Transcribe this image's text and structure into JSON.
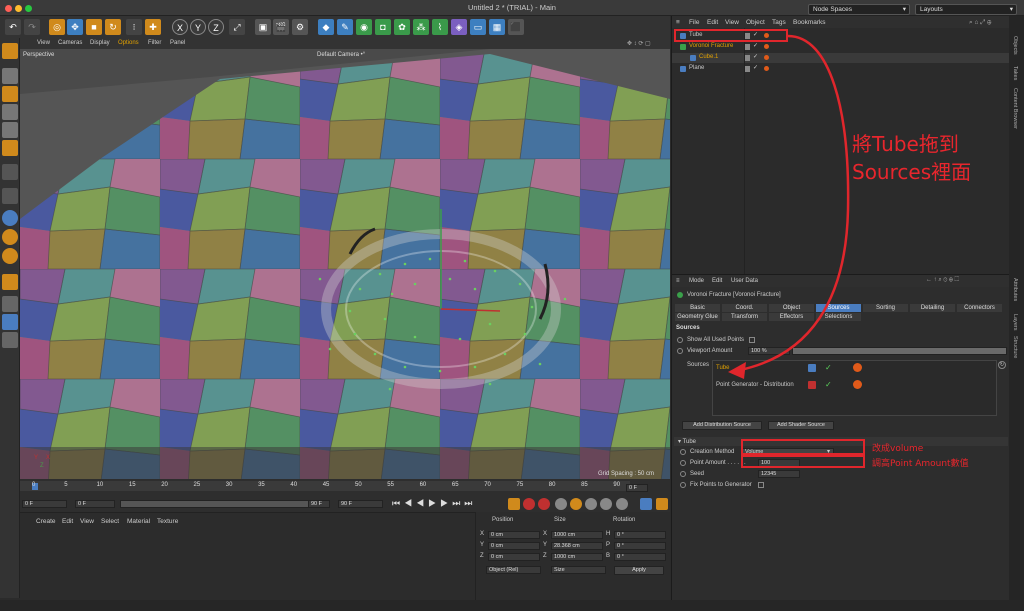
{
  "window": {
    "title": "Untitled 2 * (TRIAL) - Main",
    "node_spaces": "Node Spaces",
    "layouts": "Layouts"
  },
  "toolbar": {
    "x": "X",
    "y": "Y",
    "z": "Z"
  },
  "viewport": {
    "menu": [
      "View",
      "Cameras",
      "Display",
      "Options",
      "Filter",
      "Panel"
    ],
    "label": "Perspective",
    "camera": "Default Camera •°",
    "grid_spacing": "Grid Spacing : 50 cm"
  },
  "timeline": {
    "ticks": [
      "0",
      "5",
      "10",
      "15",
      "20",
      "25",
      "30",
      "35",
      "40",
      "45",
      "50",
      "55",
      "60",
      "65",
      "70",
      "75",
      "80",
      "85",
      "90"
    ],
    "end_frame": "0 F",
    "f1": "0 F",
    "f2": "0 F",
    "f3": "90 F",
    "f4": "90 F"
  },
  "material_manager": {
    "menu": [
      "Create",
      "Edit",
      "View",
      "Select",
      "Material",
      "Texture"
    ]
  },
  "coordinates": {
    "headers": [
      "Position",
      "Size",
      "Rotation"
    ],
    "rows": [
      {
        "axis": "X",
        "pos": "0 cm",
        "saxis": "X",
        "size": "1000 cm",
        "raxis": "H",
        "rot": "0 °"
      },
      {
        "axis": "Y",
        "pos": "0 cm",
        "saxis": "Y",
        "size": "28.368 cm",
        "raxis": "P",
        "rot": "0 °"
      },
      {
        "axis": "Z",
        "pos": "0 cm",
        "saxis": "Z",
        "size": "1000 cm",
        "raxis": "B",
        "rot": "0 °"
      }
    ],
    "mode": "Object (Rel)",
    "size_mode": "Size",
    "apply": "Apply"
  },
  "object_manager": {
    "menu": [
      "File",
      "Edit",
      "View",
      "Object",
      "Tags",
      "Bookmarks"
    ],
    "objects": [
      {
        "name": "Tube",
        "indent": 0,
        "color": "#c8c8c8"
      },
      {
        "name": "Voronoi Fracture",
        "indent": 0,
        "color": "#e0a000"
      },
      {
        "name": "Cube.1",
        "indent": 1,
        "color": "#e0a000"
      },
      {
        "name": "Plane",
        "indent": 0,
        "color": "#c8c8c8"
      }
    ]
  },
  "attributes": {
    "menu": [
      "Mode",
      "Edit",
      "User Data"
    ],
    "object_title": "Voronoi Fracture [Voronoi Fracture]",
    "tabs_row1": [
      "Basic",
      "Coord.",
      "Object",
      "Sources",
      "Sorting",
      "Detailing",
      "Connectors"
    ],
    "tabs_row2": [
      "Geometry Glue",
      "Transform",
      "Effectors",
      "Selections"
    ],
    "section": "Sources",
    "show_all": "Show All Used Points",
    "viewport_amount_label": "Viewport Amount",
    "viewport_amount": "100 %",
    "sources_label": "Sources",
    "sources": [
      {
        "name": "Tube",
        "color": "#e0a000"
      },
      {
        "name": "Point Generator - Distribution",
        "color": "#c8c8c8"
      }
    ],
    "add_distribution": "Add Distribution Source",
    "add_shader": "Add Shader Source",
    "tube_section": "▾ Tube",
    "creation_method_label": "Creation Method",
    "creation_method": "Volume",
    "point_amount_label": "Point Amount . . . . . .",
    "point_amount": "100",
    "seed_label": "Seed",
    "seed": "12345",
    "fix_points": "Fix Points to Generator"
  },
  "side_tabs": [
    "Objects",
    "Takes",
    "Content Browser",
    "Attributes",
    "Layers",
    "Structure"
  ],
  "annotations": {
    "drag_note": "將Tube拖到\nSources裡面",
    "volume_note": "改成volume",
    "amount_note": "調高Point Amount數值"
  }
}
